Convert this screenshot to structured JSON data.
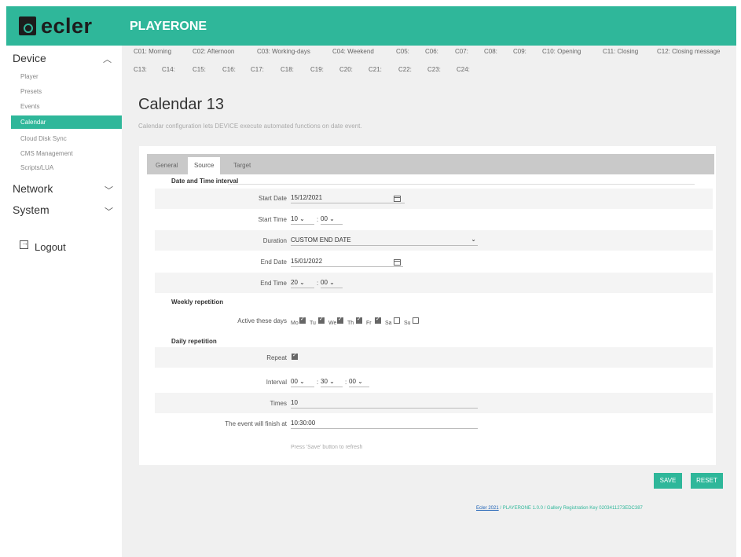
{
  "header": {
    "brand": "ecler",
    "app_title": "PLAYERONE"
  },
  "sidebar": {
    "device_label": "Device",
    "device_items": [
      "Player",
      "Presets",
      "Events",
      "Calendar",
      "Cloud Disk Sync",
      "CMS Management",
      "Scripts/LUA"
    ],
    "active_item": "Calendar",
    "network_label": "Network",
    "system_label": "System",
    "logout_label": "Logout"
  },
  "calendar_tabs": {
    "row1": [
      "C01: Morning",
      "C02: Afternoon",
      "C03: Working-days",
      "C04: Weekend",
      "C05:",
      "C06:",
      "C07:",
      "C08:",
      "C09:",
      "C10: Opening",
      "C11: Closing",
      "C12: Closing message"
    ],
    "row2": [
      "C13:",
      "C14:",
      "C15:",
      "C16:",
      "C17:",
      "C18:",
      "C19:",
      "C20:",
      "C21:",
      "C22:",
      "C23:",
      "C24:"
    ]
  },
  "page": {
    "title": "Calendar 13",
    "description": "Calendar configuration lets DEVICE execute automated functions on date event."
  },
  "form_tabs": [
    "General",
    "Source",
    "Target"
  ],
  "active_form_tab": "Source",
  "form": {
    "date_time_section": "Date and Time interval",
    "start_date_label": "Start Date",
    "start_date": "15/12/2021",
    "start_time_label": "Start Time",
    "start_hour": "10",
    "start_minute": "00",
    "duration_label": "Duration",
    "duration_value": "CUSTOM END DATE",
    "end_date_label": "End Date",
    "end_date": "15/01/2022",
    "end_time_label": "End Time",
    "end_hour": "20",
    "end_minute": "00",
    "weekly_section": "Weekly repetition",
    "active_days_label": "Active these days",
    "days": [
      {
        "label": "Mo",
        "checked": true
      },
      {
        "label": "Tu",
        "checked": true
      },
      {
        "label": "We",
        "checked": true
      },
      {
        "label": "Th",
        "checked": true
      },
      {
        "label": "Fr",
        "checked": true
      },
      {
        "label": "Sa",
        "checked": false
      },
      {
        "label": "Su",
        "checked": false
      }
    ],
    "daily_section": "Daily repetition",
    "repeat_label": "Repeat",
    "repeat_checked": true,
    "interval_label": "Interval",
    "interval_h": "00",
    "interval_m": "30",
    "interval_s": "00",
    "times_label": "Times",
    "times_value": "10",
    "finish_label": "The event will finish at",
    "finish_value": "10:30:00",
    "hint": "Press 'Save' button to refresh"
  },
  "buttons": {
    "save": "SAVE",
    "reset": "RESET"
  },
  "footer": {
    "link": "Ecler 2021",
    "text": " / PLAYERONE 1.0.0 / Gallery Registration Key 0203411273EDC387"
  },
  "colors": {
    "accent": "#2fb79a",
    "link": "#1a5fb4"
  }
}
